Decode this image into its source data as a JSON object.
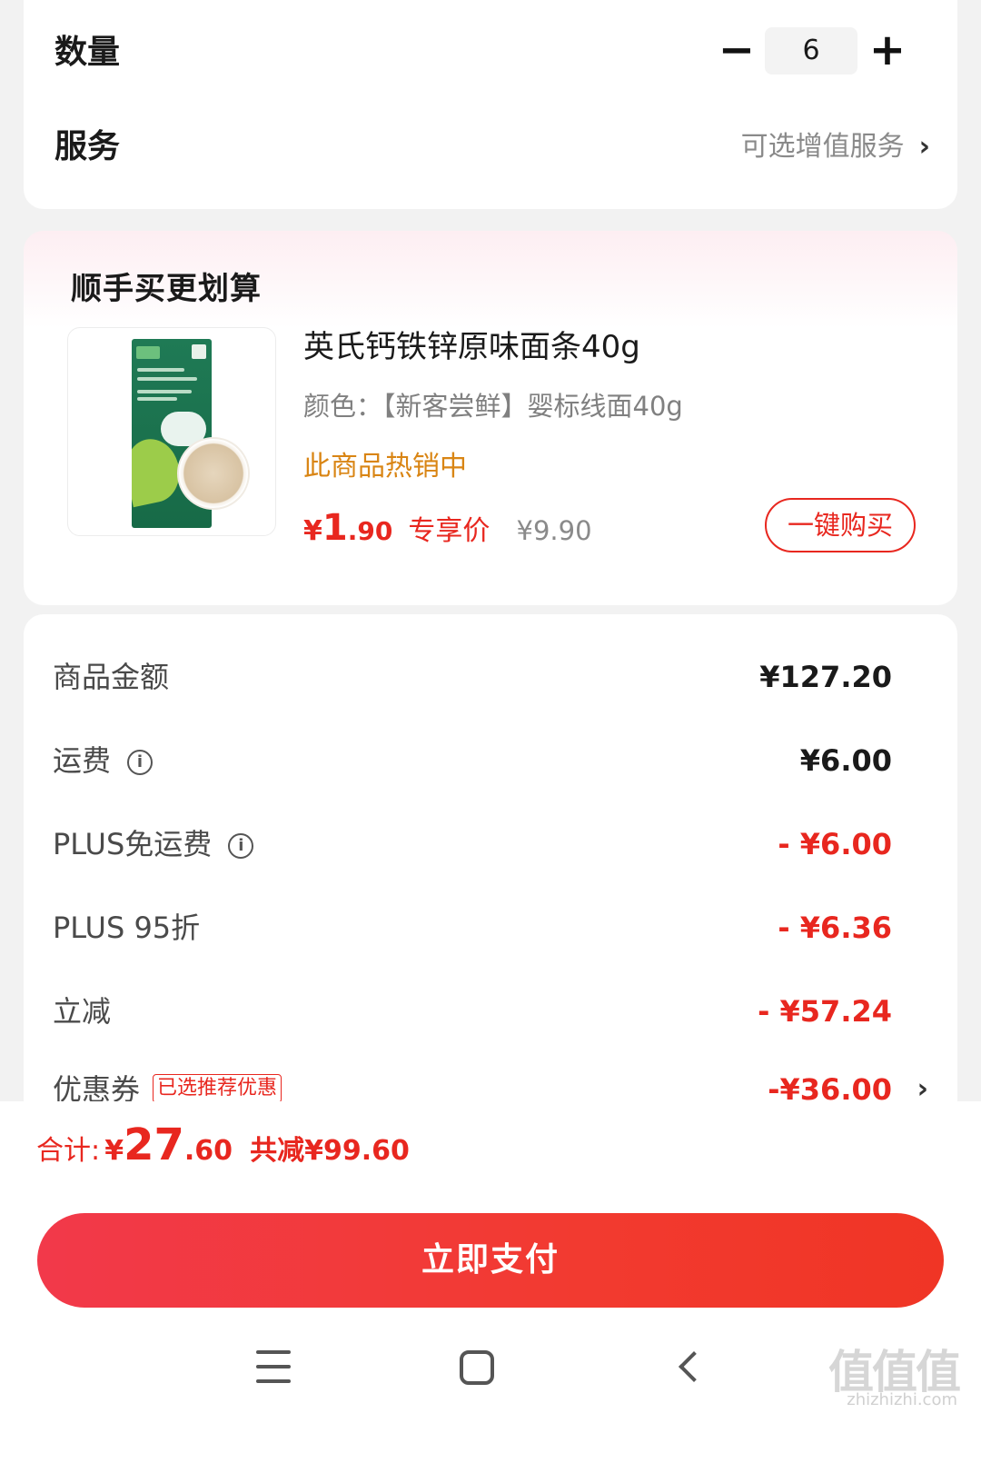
{
  "quantity": {
    "label": "数量",
    "minus": "−",
    "value": "6",
    "plus": "+"
  },
  "service": {
    "label": "服务",
    "link": "可选增值服务",
    "chevron": "›"
  },
  "upsell": {
    "title": "顺手买更划算",
    "product": {
      "name": "英氏钙铁锌原味面条40g",
      "variant": "颜色：【新客尝鲜】婴标线面40g",
      "hot_sale": "此商品热销中",
      "price_currency": "¥",
      "price_int": "1",
      "price_dec": ".90",
      "price_tag": "专享价",
      "old_price": "¥9.90",
      "buy_button": "一键购买"
    }
  },
  "summary": {
    "rows": [
      {
        "label": "商品金额",
        "value": "¥127.20"
      },
      {
        "label": "运费",
        "value": "¥6.00"
      },
      {
        "label": "PLUS免运费",
        "value": "- ¥6.00"
      },
      {
        "label": "PLUS 95折",
        "value": "- ¥6.36"
      },
      {
        "label": "立减",
        "value": "- ¥57.24"
      },
      {
        "label": "优惠券",
        "badge": "已选推荐优惠",
        "value": "-¥36.00",
        "chevron": "›"
      }
    ],
    "info_icon": "i"
  },
  "footer": {
    "total_label": "合计:",
    "total_currency": "¥",
    "total_int": "27",
    "total_dec": ".60",
    "saved": "共减¥99.60",
    "pay_button": "立即支付"
  },
  "watermark": {
    "main": "值值值",
    "sub": "zhizhizhi.com"
  },
  "colors": {
    "accent": "#e8271f",
    "hot_sale": "#d98514",
    "pay_gradient_start": "#f2394a",
    "pay_gradient_end": "#f03525"
  }
}
